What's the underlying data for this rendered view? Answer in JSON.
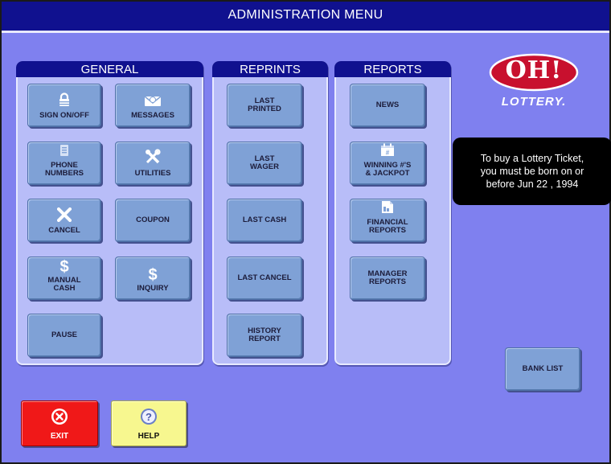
{
  "title": "ADMINISTRATION MENU",
  "panels": {
    "general": {
      "heading": "GENERAL",
      "buttons": {
        "sign_on_off": "SIGN ON/OFF",
        "messages": "MESSAGES",
        "phone_numbers_1": "PHONE",
        "phone_numbers_2": "NUMBERS",
        "utilities": "UTILITIES",
        "cancel": "CANCEL",
        "coupon": "COUPON",
        "manual_cash_1": "MANUAL",
        "manual_cash_2": "CASH",
        "inquiry": "INQUIRY",
        "pause": "PAUSE"
      }
    },
    "reprints": {
      "heading": "REPRINTS",
      "buttons": {
        "last_printed_1": "LAST",
        "last_printed_2": "PRINTED",
        "last_wager_1": "LAST",
        "last_wager_2": "WAGER",
        "last_cash": "LAST CASH",
        "last_cancel": "LAST CANCEL",
        "history_report_1": "HISTORY",
        "history_report_2": "REPORT"
      }
    },
    "reports": {
      "heading": "REPORTS",
      "buttons": {
        "news": "NEWS",
        "winning_1": "WINNING #'S",
        "winning_2": "& JACKPOT",
        "financial_1": "FINANCIAL",
        "financial_2": "REPORTS",
        "manager_1": "MANAGER",
        "manager_2": "REPORTS"
      }
    }
  },
  "logo": {
    "mark": "OH!",
    "word": "LOTTERY."
  },
  "notice": {
    "line1": "To buy a Lottery Ticket,",
    "line2": "you must be born on or",
    "line3": "before Jun 22 , 1994"
  },
  "bank_list": "BANK LIST",
  "exit": "EXIT",
  "help": "HELP",
  "icons": {
    "sign_on_off": "lock-icon",
    "messages": "envelope-icon",
    "phone_numbers": "phone-book-icon",
    "utilities": "tools-icon",
    "cancel": "x-icon",
    "manual_cash": "dollar-icon",
    "inquiry": "dollar-icon",
    "winning": "calendar-icon",
    "financial": "document-icon",
    "exit": "close-circle-icon",
    "help": "question-circle-icon"
  },
  "colors": {
    "background": "#7f80ef",
    "title_bar": "#10118f",
    "panel": "#b8bdf8",
    "button": "#7fa1d6",
    "exit": "#f01818",
    "help": "#f7f78f",
    "logo_red": "#c8102e"
  }
}
